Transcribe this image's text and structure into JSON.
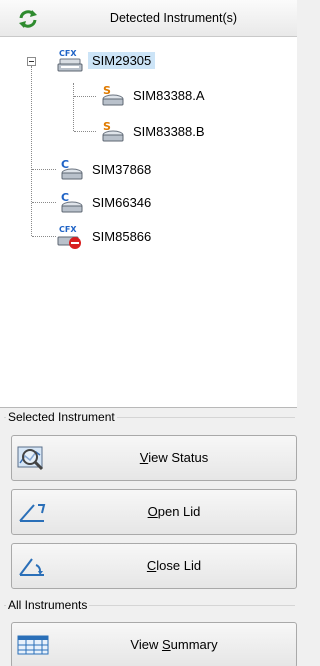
{
  "header": {
    "title": "Detected Instrument(s)",
    "refresh_icon": "refresh-icon"
  },
  "tree": {
    "nodes": [
      {
        "label": "SIM29305",
        "badge": "CFX",
        "icon": "cfx-instrument-icon",
        "selected": true
      },
      {
        "label": "SIM83388.A",
        "badge": "S",
        "icon": "s-block-icon"
      },
      {
        "label": "SIM83388.B",
        "badge": "S",
        "icon": "s-block-icon"
      },
      {
        "label": "SIM37868",
        "badge": "C",
        "icon": "c-instrument-icon"
      },
      {
        "label": "SIM66346",
        "badge": "C",
        "icon": "c-instrument-icon"
      },
      {
        "label": "SIM85866",
        "badge": "CFX",
        "icon": "cfx-error-instrument-icon"
      }
    ]
  },
  "selected_instrument": {
    "group_label": "Selected Instrument",
    "buttons": [
      {
        "pre": "",
        "mnemonic": "V",
        "post": "iew Status",
        "icon": "view-status-icon"
      },
      {
        "pre": "",
        "mnemonic": "O",
        "post": "pen Lid",
        "icon": "open-lid-icon"
      },
      {
        "pre": "",
        "mnemonic": "C",
        "post": "lose Lid",
        "icon": "close-lid-icon"
      }
    ]
  },
  "all_instruments": {
    "group_label": "All Instruments",
    "buttons": [
      {
        "pre": "View ",
        "mnemonic": "S",
        "post": "ummary",
        "icon": "summary-table-icon"
      }
    ]
  },
  "colors": {
    "selection": "#cce4f7",
    "badge_blue": "#1f63c6",
    "badge_orange": "#e07b00",
    "error_red": "#d81f1f"
  }
}
